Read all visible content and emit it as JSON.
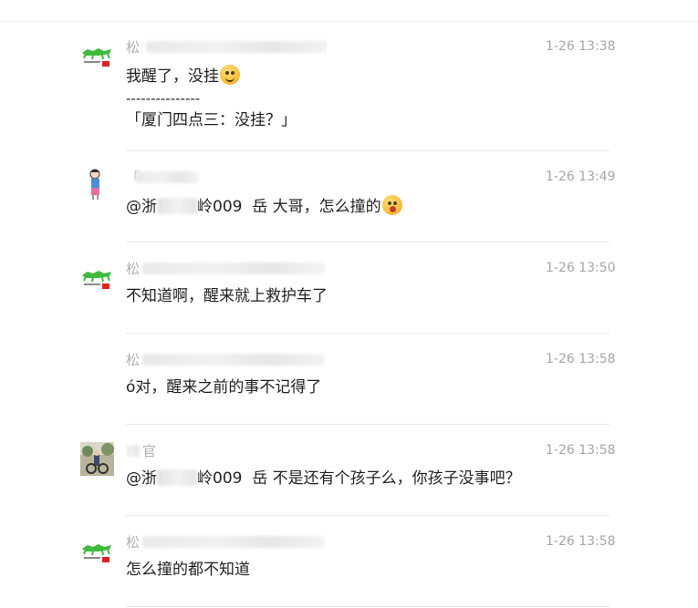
{
  "messages": [
    {
      "sender": "松",
      "time": "1-26 13:38",
      "lines": [
        "我醒了，没挂",
        "---------------",
        "「厦门四点三：没挂？」"
      ],
      "avatar_icon": "crocodile-icon",
      "emoji_icon": "smirk-emoji-icon"
    },
    {
      "sender": "「",
      "time": "1-26 13:49",
      "mention_prefix": "@浙",
      "mention_suffix": "岭009",
      "text": "岳 大哥，怎么撞的",
      "avatar_icon": "cartoon-girl-icon",
      "emoji_icon": "drooling-emoji-icon"
    },
    {
      "sender": "松",
      "time": "1-26 13:50",
      "text": "不知道啊，醒来就上救护车了",
      "avatar_icon": "crocodile-icon"
    },
    {
      "sender": "松",
      "time": "1-26 13:58",
      "text": "ó对，醒来之前的事不记得了"
    },
    {
      "sender": "官",
      "time": "1-26 13:58",
      "mention_prefix": "@浙",
      "mention_suffix": "岭009",
      "text": "岳 不是还有个孩子么，你孩子没事吧？",
      "avatar_icon": "photo-avatar-icon"
    },
    {
      "sender": "松",
      "time": "1-26 13:58",
      "text": "怎么撞的都不知道",
      "avatar_icon": "crocodile-icon"
    }
  ]
}
